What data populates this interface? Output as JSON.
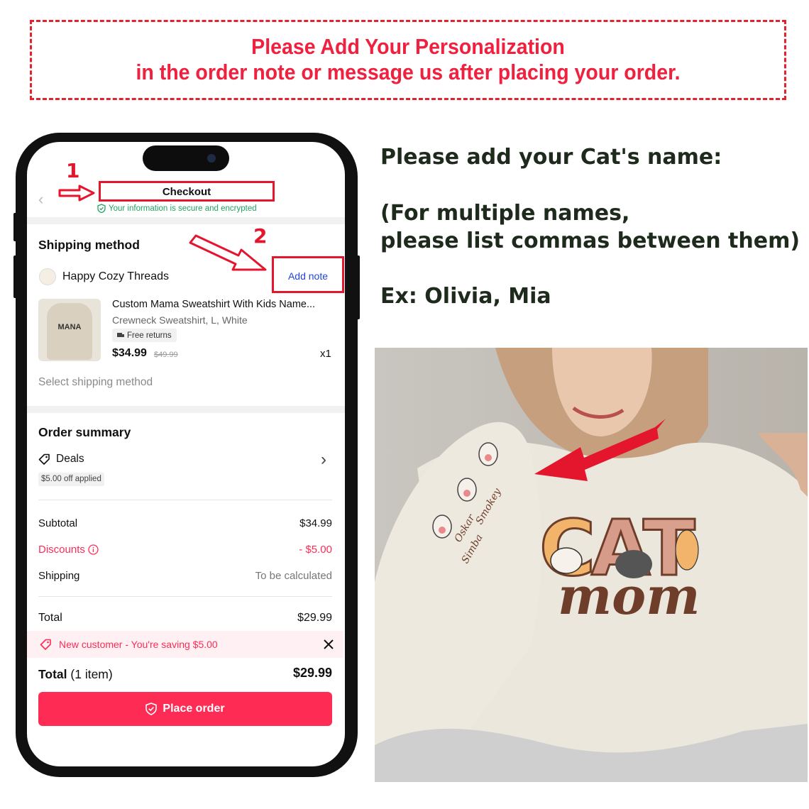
{
  "banner": {
    "line1": "Please Add Your Personalization",
    "line2": "in the order note or message us after placing your order."
  },
  "instructions": {
    "heading": "Please add your Cat's name:",
    "multi_line1": "(For multiple names,",
    "multi_line2": "please list commas between them)",
    "example": "Ex: Olivia, Mia"
  },
  "steps": {
    "step1": "1",
    "step2": "2"
  },
  "checkout": {
    "title": "Checkout",
    "secure_text": "Your information is secure and encrypted",
    "shipping_heading": "Shipping method",
    "store_name": "Happy Cozy Threads",
    "add_note": "Add note",
    "product": {
      "name": "Custom Mama Sweatshirt With Kids Name...",
      "variant": "Crewneck Sweatshirt, L, White",
      "badge": "Free returns",
      "price": "$34.99",
      "original_price": "$49.99",
      "quantity": "x1",
      "thumb_text": "MANA"
    },
    "select_shipping": "Select shipping method",
    "summary_heading": "Order summary",
    "deals_label": "Deals",
    "deals_badge": "$5.00 off applied",
    "subtotal_label": "Subtotal",
    "subtotal_value": "$34.99",
    "discounts_label": "Discounts",
    "discounts_value": "- $5.00",
    "shipping_label": "Shipping",
    "shipping_value": "To be calculated",
    "total_label": "Total",
    "total_value": "$29.99",
    "promo_text": "New customer - You're saving $5.00",
    "footer_total_label": "Total",
    "footer_items": "(1 item)",
    "footer_total_value": "$29.99",
    "place_order": "Place order"
  },
  "photo": {
    "graphic_word_1": "CAT",
    "graphic_word_2": "mom",
    "sleeve_names": [
      "Simba",
      "Oskar",
      "Smokey"
    ]
  },
  "colors": {
    "accent_red": "#fe2c55",
    "banner_red": "#f0213f",
    "annotation_red": "#e4162d",
    "secure_green": "#1fa35f",
    "link_blue": "#2146d6",
    "text_dark": "#1d2a1c"
  }
}
